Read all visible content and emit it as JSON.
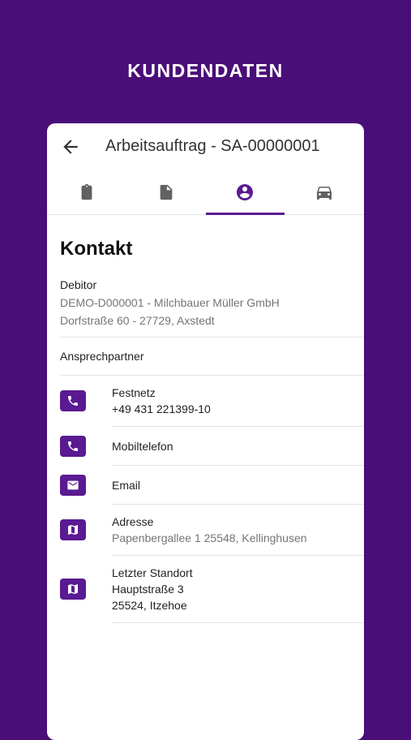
{
  "screen_title": "KUNDENDATEN",
  "toolbar": {
    "title": "Arbeitsauftrag - SA-00000001"
  },
  "tabs": [
    {
      "icon": "clipboard-icon",
      "active": false
    },
    {
      "icon": "document-icon",
      "active": false
    },
    {
      "icon": "account-circle-icon",
      "active": true
    },
    {
      "icon": "car-icon",
      "active": false
    }
  ],
  "section": {
    "title": "Kontakt"
  },
  "debitor": {
    "label": "Debitor",
    "line1": "DEMO-D000001 - Milchbauer Müller GmbH",
    "line2": "Dorfstraße 60 - 27729, Axstedt"
  },
  "contact_person": {
    "label": "Ansprechpartner"
  },
  "items": [
    {
      "icon": "phone-icon",
      "label": "Festnetz",
      "value": "+49 431 221399-10"
    },
    {
      "icon": "phone-icon",
      "label": "Mobiltelefon"
    },
    {
      "icon": "mail-icon",
      "label": "Email"
    },
    {
      "icon": "map-icon",
      "label": "Adresse",
      "value": "Papenbergallee 1 25548, Kellinghusen"
    },
    {
      "icon": "map-icon",
      "label": "Letzter Standort",
      "value": "Hauptstraße 3",
      "value2": "25524, Itzehoe"
    }
  ],
  "colors": {
    "brand": "#4a0e78",
    "accent": "#5a1a92"
  }
}
